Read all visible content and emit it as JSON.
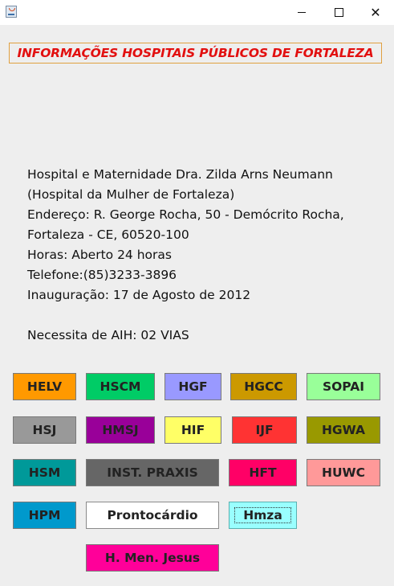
{
  "window": {
    "icon": "java-cup-icon",
    "controls": {
      "minimize": "minimize-icon",
      "maximize": "maximize-icon",
      "close": "close-icon"
    }
  },
  "heading": "INFORMAÇÕES HOSPITAIS PÚBLICOS DE FORTALEZA",
  "info": {
    "line1": "Hospital e Maternidade Dra. Zilda Arns Neumann",
    "line2": "(Hospital da Mulher de Fortaleza)",
    "line3": "Endereço: R. George Rocha, 50 - Demócrito Rocha,",
    "line4": "Fortaleza - CE, 60520-100",
    "line5": "Horas: Aberto 24 horas",
    "line6": "Telefone:(85)3233-3896",
    "line7": "Inauguração: 17 de Agosto de 2012",
    "line8": "Necessita de AIH: 02 VIAS"
  },
  "buttons": {
    "helv": {
      "label": "HELV",
      "color": "#ff9900"
    },
    "hscm": {
      "label": "HSCM",
      "color": "#00cc66"
    },
    "hgf": {
      "label": "HGF",
      "color": "#9999ff"
    },
    "hgcc": {
      "label": "HGCC",
      "color": "#cc9900"
    },
    "sopai": {
      "label": "SOPAI",
      "color": "#99ff99"
    },
    "hsj": {
      "label": "HSJ",
      "color": "#999999"
    },
    "hmsj": {
      "label": "HMSJ",
      "color": "#990099"
    },
    "hif": {
      "label": "HIF",
      "color": "#ffff66"
    },
    "ijf": {
      "label": "IJF",
      "color": "#ff3333"
    },
    "hgwa": {
      "label": "HGWA",
      "color": "#999900"
    },
    "hsm": {
      "label": "HSM",
      "color": "#009999"
    },
    "inst_praxis": {
      "label": "INST. PRAXIS",
      "color": "#666666"
    },
    "hft": {
      "label": "HFT",
      "color": "#ff0066"
    },
    "huwc": {
      "label": "HUWC",
      "color": "#ff9999"
    },
    "hpm": {
      "label": "HPM",
      "color": "#0099cc"
    },
    "prontocardio": {
      "label": "Prontocárdio",
      "color": "#ffffff"
    },
    "hmza": {
      "label": "Hmza",
      "color": "#99ffff"
    },
    "h_men_jesus": {
      "label": "H. Men. Jesus",
      "color": "#ff0099"
    }
  }
}
